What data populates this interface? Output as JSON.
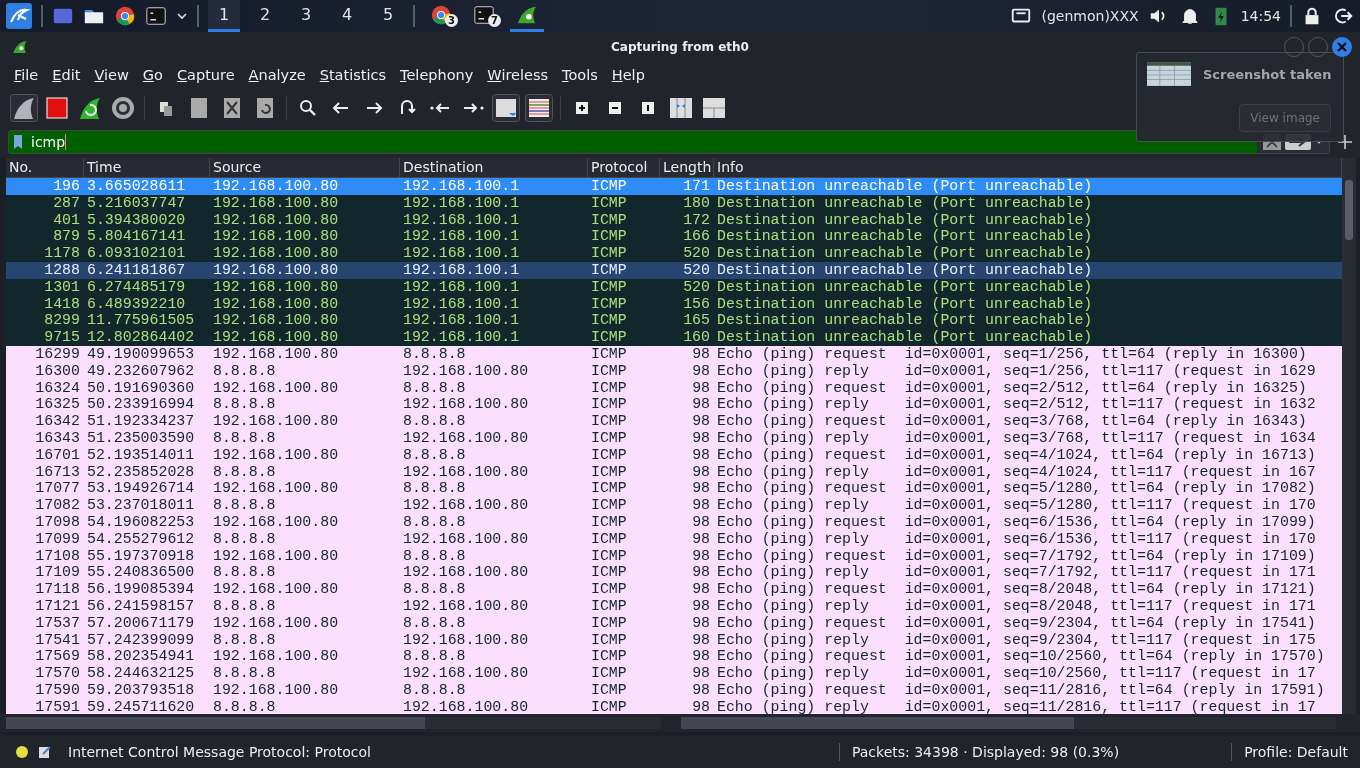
{
  "taskbar": {
    "workspaces": [
      {
        "label": "1",
        "selected": true
      },
      {
        "label": "2",
        "selected": false
      },
      {
        "label": "3",
        "selected": false
      },
      {
        "label": "4",
        "selected": false
      },
      {
        "label": "5",
        "selected": false
      }
    ],
    "running_apps": [
      {
        "kind": "browser",
        "badge": "3",
        "selected": false
      },
      {
        "kind": "terminal",
        "badge": "7",
        "selected": false
      },
      {
        "kind": "shark",
        "selected": true
      }
    ],
    "tray_label": "(genmon)XXX",
    "clock": "14:54"
  },
  "window": {
    "title": "Capturing from eth0"
  },
  "menu": [
    "File",
    "Edit",
    "View",
    "Go",
    "Capture",
    "Analyze",
    "Statistics",
    "Telephony",
    "Wireless",
    "Tools",
    "Help"
  ],
  "filter": {
    "value": "icmp"
  },
  "columns": [
    "No.",
    "Time",
    "Source",
    "Destination",
    "Protocol",
    "Length",
    "Info"
  ],
  "rows": [
    {
      "kind": "error",
      "selected": true,
      "highlighted": false,
      "cells": [
        "196",
        "3.665028611",
        "192.168.100.80",
        "192.168.100.1",
        "ICMP",
        "171",
        "Destination unreachable (Port unreachable)"
      ]
    },
    {
      "kind": "error",
      "selected": false,
      "highlighted": false,
      "cells": [
        "287",
        "5.216037747",
        "192.168.100.80",
        "192.168.100.1",
        "ICMP",
        "180",
        "Destination unreachable (Port unreachable)"
      ]
    },
    {
      "kind": "error",
      "selected": false,
      "highlighted": false,
      "cells": [
        "401",
        "5.394380020",
        "192.168.100.80",
        "192.168.100.1",
        "ICMP",
        "172",
        "Destination unreachable (Port unreachable)"
      ]
    },
    {
      "kind": "error",
      "selected": false,
      "highlighted": false,
      "cells": [
        "879",
        "5.804167141",
        "192.168.100.80",
        "192.168.100.1",
        "ICMP",
        "166",
        "Destination unreachable (Port unreachable)"
      ]
    },
    {
      "kind": "error",
      "selected": false,
      "highlighted": false,
      "cells": [
        "1178",
        "6.093102101",
        "192.168.100.80",
        "192.168.100.1",
        "ICMP",
        "520",
        "Destination unreachable (Port unreachable)"
      ]
    },
    {
      "kind": "error",
      "selected": false,
      "highlighted": true,
      "cells": [
        "1288",
        "6.241181867",
        "192.168.100.80",
        "192.168.100.1",
        "ICMP",
        "520",
        "Destination unreachable (Port unreachable)"
      ]
    },
    {
      "kind": "error",
      "selected": false,
      "highlighted": false,
      "cells": [
        "1301",
        "6.274485179",
        "192.168.100.80",
        "192.168.100.1",
        "ICMP",
        "520",
        "Destination unreachable (Port unreachable)"
      ]
    },
    {
      "kind": "error",
      "selected": false,
      "highlighted": false,
      "cells": [
        "1418",
        "6.489392210",
        "192.168.100.80",
        "192.168.100.1",
        "ICMP",
        "156",
        "Destination unreachable (Port unreachable)"
      ]
    },
    {
      "kind": "error",
      "selected": false,
      "highlighted": false,
      "cells": [
        "8299",
        "11.775961505",
        "192.168.100.80",
        "192.168.100.1",
        "ICMP",
        "165",
        "Destination unreachable (Port unreachable)"
      ]
    },
    {
      "kind": "error",
      "selected": false,
      "highlighted": false,
      "cells": [
        "9715",
        "12.802864402",
        "192.168.100.80",
        "192.168.100.1",
        "ICMP",
        "160",
        "Destination unreachable (Port unreachable)"
      ]
    },
    {
      "kind": "echo",
      "selected": false,
      "highlighted": false,
      "cells": [
        "16299",
        "49.190099653",
        "192.168.100.80",
        "8.8.8.8",
        "ICMP",
        "98",
        "Echo (ping) request  id=0x0001, seq=1/256, ttl=64 (reply in 16300)"
      ]
    },
    {
      "kind": "echo",
      "selected": false,
      "highlighted": false,
      "cells": [
        "16300",
        "49.232607962",
        "8.8.8.8",
        "192.168.100.80",
        "ICMP",
        "98",
        "Echo (ping) reply    id=0x0001, seq=1/256, ttl=117 (request in 1629"
      ]
    },
    {
      "kind": "echo",
      "selected": false,
      "highlighted": false,
      "cells": [
        "16324",
        "50.191690360",
        "192.168.100.80",
        "8.8.8.8",
        "ICMP",
        "98",
        "Echo (ping) request  id=0x0001, seq=2/512, ttl=64 (reply in 16325)"
      ]
    },
    {
      "kind": "echo",
      "selected": false,
      "highlighted": false,
      "cells": [
        "16325",
        "50.233916994",
        "8.8.8.8",
        "192.168.100.80",
        "ICMP",
        "98",
        "Echo (ping) reply    id=0x0001, seq=2/512, ttl=117 (request in 1632"
      ]
    },
    {
      "kind": "echo",
      "selected": false,
      "highlighted": false,
      "cells": [
        "16342",
        "51.192334237",
        "192.168.100.80",
        "8.8.8.8",
        "ICMP",
        "98",
        "Echo (ping) request  id=0x0001, seq=3/768, ttl=64 (reply in 16343)"
      ]
    },
    {
      "kind": "echo",
      "selected": false,
      "highlighted": false,
      "cells": [
        "16343",
        "51.235003590",
        "8.8.8.8",
        "192.168.100.80",
        "ICMP",
        "98",
        "Echo (ping) reply    id=0x0001, seq=3/768, ttl=117 (request in 1634"
      ]
    },
    {
      "kind": "echo",
      "selected": false,
      "highlighted": false,
      "cells": [
        "16701",
        "52.193514011",
        "192.168.100.80",
        "8.8.8.8",
        "ICMP",
        "98",
        "Echo (ping) request  id=0x0001, seq=4/1024, ttl=64 (reply in 16713)"
      ]
    },
    {
      "kind": "echo",
      "selected": false,
      "highlighted": false,
      "cells": [
        "16713",
        "52.235852028",
        "8.8.8.8",
        "192.168.100.80",
        "ICMP",
        "98",
        "Echo (ping) reply    id=0x0001, seq=4/1024, ttl=117 (request in 167"
      ]
    },
    {
      "kind": "echo",
      "selected": false,
      "highlighted": false,
      "cells": [
        "17077",
        "53.194926714",
        "192.168.100.80",
        "8.8.8.8",
        "ICMP",
        "98",
        "Echo (ping) request  id=0x0001, seq=5/1280, ttl=64 (reply in 17082)"
      ]
    },
    {
      "kind": "echo",
      "selected": false,
      "highlighted": false,
      "cells": [
        "17082",
        "53.237018011",
        "8.8.8.8",
        "192.168.100.80",
        "ICMP",
        "98",
        "Echo (ping) reply    id=0x0001, seq=5/1280, ttl=117 (request in 170"
      ]
    },
    {
      "kind": "echo",
      "selected": false,
      "highlighted": false,
      "cells": [
        "17098",
        "54.196082253",
        "192.168.100.80",
        "8.8.8.8",
        "ICMP",
        "98",
        "Echo (ping) request  id=0x0001, seq=6/1536, ttl=64 (reply in 17099)"
      ]
    },
    {
      "kind": "echo",
      "selected": false,
      "highlighted": false,
      "cells": [
        "17099",
        "54.255279612",
        "8.8.8.8",
        "192.168.100.80",
        "ICMP",
        "98",
        "Echo (ping) reply    id=0x0001, seq=6/1536, ttl=117 (request in 170"
      ]
    },
    {
      "kind": "echo",
      "selected": false,
      "highlighted": false,
      "cells": [
        "17108",
        "55.197370918",
        "192.168.100.80",
        "8.8.8.8",
        "ICMP",
        "98",
        "Echo (ping) request  id=0x0001, seq=7/1792, ttl=64 (reply in 17109)"
      ]
    },
    {
      "kind": "echo",
      "selected": false,
      "highlighted": false,
      "cells": [
        "17109",
        "55.240836500",
        "8.8.8.8",
        "192.168.100.80",
        "ICMP",
        "98",
        "Echo (ping) reply    id=0x0001, seq=7/1792, ttl=117 (request in 171"
      ]
    },
    {
      "kind": "echo",
      "selected": false,
      "highlighted": false,
      "cells": [
        "17118",
        "56.199085394",
        "192.168.100.80",
        "8.8.8.8",
        "ICMP",
        "98",
        "Echo (ping) request  id=0x0001, seq=8/2048, ttl=64 (reply in 17121)"
      ]
    },
    {
      "kind": "echo",
      "selected": false,
      "highlighted": false,
      "cells": [
        "17121",
        "56.241598157",
        "8.8.8.8",
        "192.168.100.80",
        "ICMP",
        "98",
        "Echo (ping) reply    id=0x0001, seq=8/2048, ttl=117 (request in 171"
      ]
    },
    {
      "kind": "echo",
      "selected": false,
      "highlighted": false,
      "cells": [
        "17537",
        "57.200671179",
        "192.168.100.80",
        "8.8.8.8",
        "ICMP",
        "98",
        "Echo (ping) request  id=0x0001, seq=9/2304, ttl=64 (reply in 17541)"
      ]
    },
    {
      "kind": "echo",
      "selected": false,
      "highlighted": false,
      "cells": [
        "17541",
        "57.242399099",
        "8.8.8.8",
        "192.168.100.80",
        "ICMP",
        "98",
        "Echo (ping) reply    id=0x0001, seq=9/2304, ttl=117 (request in 175"
      ]
    },
    {
      "kind": "echo",
      "selected": false,
      "highlighted": false,
      "cells": [
        "17569",
        "58.202354941",
        "192.168.100.80",
        "8.8.8.8",
        "ICMP",
        "98",
        "Echo (ping) request  id=0x0001, seq=10/2560, ttl=64 (reply in 17570)"
      ]
    },
    {
      "kind": "echo",
      "selected": false,
      "highlighted": false,
      "cells": [
        "17570",
        "58.244632125",
        "8.8.8.8",
        "192.168.100.80",
        "ICMP",
        "98",
        "Echo (ping) reply    id=0x0001, seq=10/2560, ttl=117 (request in 17"
      ]
    },
    {
      "kind": "echo",
      "selected": false,
      "highlighted": false,
      "cells": [
        "17590",
        "59.203793518",
        "192.168.100.80",
        "8.8.8.8",
        "ICMP",
        "98",
        "Echo (ping) request  id=0x0001, seq=11/2816, ttl=64 (reply in 17591)"
      ]
    },
    {
      "kind": "echo",
      "selected": false,
      "highlighted": false,
      "cells": [
        "17591",
        "59.245711620",
        "8.8.8.8",
        "192.168.100.80",
        "ICMP",
        "98",
        "Echo (ping) reply    id=0x0001, seq=11/2816, ttl=117 (request in 17"
      ]
    }
  ],
  "status_bar": {
    "protocol_text": "Internet Control Message Protocol: Protocol",
    "packets": "Packets: 34398 · Displayed: 98 (0.3%)",
    "profile": "Profile: Default"
  },
  "notification": {
    "title": "Screenshot taken",
    "button": "View image"
  }
}
